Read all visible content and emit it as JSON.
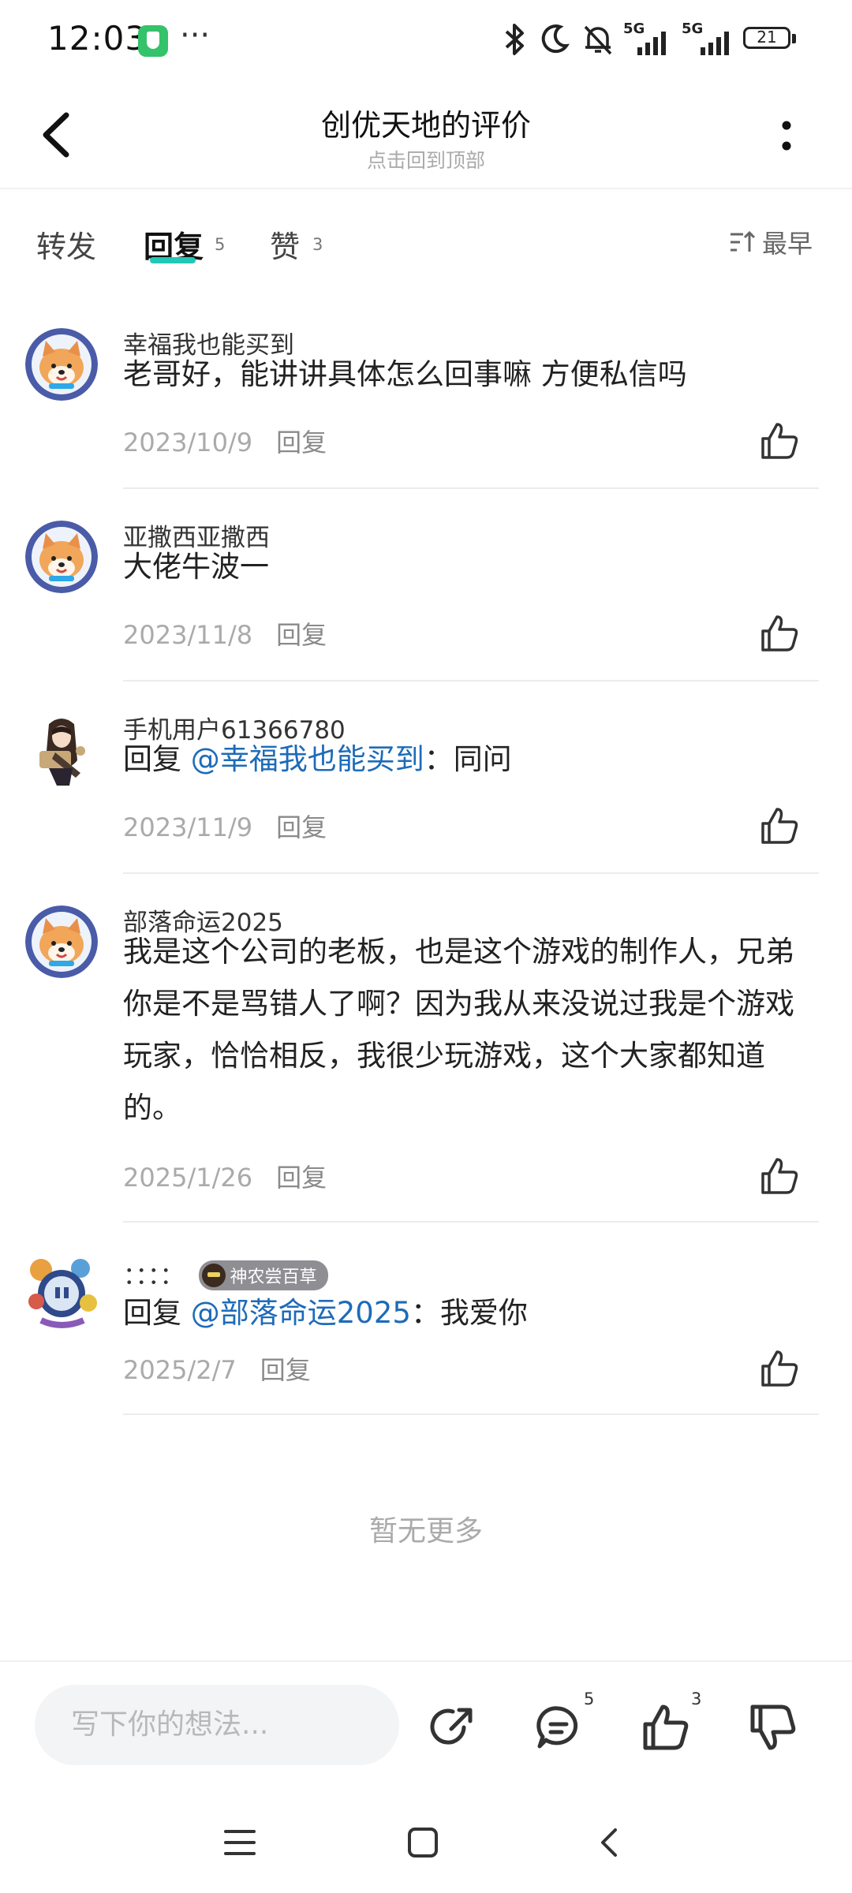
{
  "status_bar": {
    "time": "12:03",
    "more_dots": "···",
    "battery_level": "21",
    "network_1": "5G",
    "network_2": "5G"
  },
  "header": {
    "title": "创优天地的评价",
    "subtitle": "点击回到顶部"
  },
  "tabs": {
    "forward": "转发",
    "reply": "回复",
    "reply_count": "5",
    "like": "赞",
    "like_count": "3",
    "sort_label": "最早"
  },
  "comments": [
    {
      "name": "幸福我也能买到",
      "text": "老哥好，能讲讲具体怎么回事嘛 方便私信吗",
      "date": "2023/10/9",
      "reply_label": "回复",
      "avatar": "shiba-avatar"
    },
    {
      "name": "亚撒西亚撒西",
      "text": "大佬牛波一",
      "date": "2023/11/8",
      "reply_label": "回复",
      "avatar": "shiba-avatar"
    },
    {
      "name": "手机用户61366780",
      "reply_prefix": "回复 ",
      "mention": "@幸福我也能买到",
      "text_after": "：同问",
      "date": "2023/11/9",
      "reply_label": "回复",
      "avatar": "anime-girl-avatar"
    },
    {
      "name": "部落命运2025",
      "text": "我是这个公司的老板，也是这个游戏的制作人，兄弟你是不是骂错人了啊？因为我从来没说过我是个游戏玩家，恰恰相反，我很少玩游戏，这个大家都知道的。",
      "date": "2025/1/26",
      "reply_label": "回复",
      "avatar": "shiba-avatar"
    },
    {
      "name": "：：：：",
      "badge": "神农尝百草",
      "reply_prefix": "回复 ",
      "mention": "@部落命运2025",
      "text_after": "：我爱你",
      "date": "2025/2/7",
      "reply_label": "回复",
      "avatar": "game-character-avatar"
    }
  ],
  "no_more": "暂无更多",
  "bottom_bar": {
    "input_placeholder": "写下你的想法...",
    "comment_count": "5",
    "like_count": "3"
  },
  "colors": {
    "accent": "#22c7b6",
    "mention": "#1d6bb8",
    "shield": "#34c26a"
  }
}
